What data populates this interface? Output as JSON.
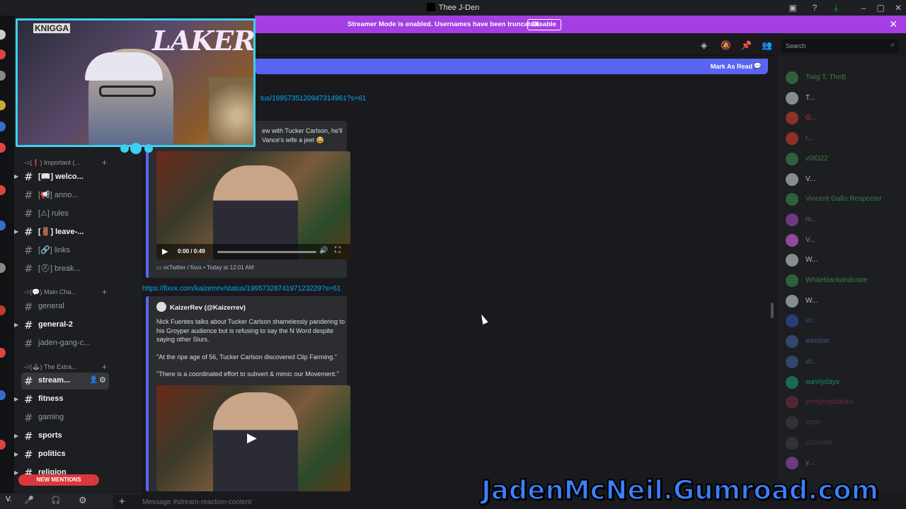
{
  "window": {
    "title": "Thee J-Den"
  },
  "banner": {
    "text": "Streamer Mode is enabled. Usernames have been truncated.",
    "disable_label": "Disable"
  },
  "header": {
    "search_placeholder": "Search"
  },
  "new_messages_bar": {
    "label": "Mark As Read"
  },
  "sidebar": {
    "categories": [
      {
        "label": "-=(❗) Important (...",
        "plus": "+"
      },
      {
        "label": "-=(💬) Main Cha...",
        "plus": "+"
      },
      {
        "label": "-=(🕹) The Extra...",
        "plus": "+"
      }
    ],
    "channels": [
      {
        "name": "[📖] welco...",
        "bold": true
      },
      {
        "name": "[📢] anno...",
        "bold": false
      },
      {
        "name": "[⚠] rules",
        "bold": false
      },
      {
        "name": "[🚪] leave-...",
        "bold": true
      },
      {
        "name": "[🔗] links",
        "bold": false
      },
      {
        "name": "[⛑] break...",
        "bold": false
      },
      {
        "name": "general",
        "bold": false
      },
      {
        "name": "general-2",
        "bold": true
      },
      {
        "name": "jaden-gang-c...",
        "bold": false
      },
      {
        "name": "stream...",
        "bold": true,
        "selected": true
      },
      {
        "name": "fitness",
        "bold": true
      },
      {
        "name": "gaming",
        "bold": false
      },
      {
        "name": "sports",
        "bold": true
      },
      {
        "name": "politics",
        "bold": true
      },
      {
        "name": "religion",
        "bold": true
      }
    ],
    "new_mentions": "NEW MENTIONS"
  },
  "messages": {
    "link1": "tus/1995735120947314961?s=61",
    "embed1": {
      "desc_line1": "ew with Tucker Carlson, he'll",
      "desc_line2": "Vance's wife a jeet 😂",
      "video_time": "0:00 / 0:49",
      "footer": "vxTwitter / fixvx • Today at 12:01 AM"
    },
    "link2": "https://fixvx.com/kaizerrev/status/1995732874197123229?s=61",
    "embed2": {
      "author": "KaizerRev (@Kaizerrev)",
      "p1": "Nick Fuentes talks about Tucker Carlson shamelessly pandering to his Groyper audience but is refusing to say the N Word despite saying other Slurs.",
      "p2": "\"At the ripe age of 56, Tucker Carlson discovered Clip Farming.\"",
      "p3": "\"There is a coordinated effort to subvert & mimic our Movement.\""
    }
  },
  "members": [
    {
      "name": "Twig T. TheB",
      "color": "#3a7a4a"
    },
    {
      "name": "T...",
      "color": "#b5bac1"
    },
    {
      "name": "G...",
      "color": "#c0392b"
    },
    {
      "name": "r...",
      "color": "#c0392b"
    },
    {
      "name": "v0ID22",
      "color": "#3a7a4a"
    },
    {
      "name": "V...",
      "color": "#b5bac1"
    },
    {
      "name": "Vincent Gallo Respecter",
      "color": "#3a7a4a"
    },
    {
      "name": "m...",
      "color": "#8e44ad"
    },
    {
      "name": "V...",
      "color": "#c45ad6"
    },
    {
      "name": "W...",
      "color": "#b5bac1"
    },
    {
      "name": "Whiteblackandcrate",
      "color": "#3a7a4a"
    },
    {
      "name": "W...",
      "color": "#b5bac1"
    },
    {
      "name": "vc...",
      "color": "#2e4a9a"
    },
    {
      "name": "winston",
      "color": "#3a5a8a"
    },
    {
      "name": "vc...",
      "color": "#3a5a8a"
    },
    {
      "name": "sunnydays",
      "color": "#1a8a6a"
    },
    {
      "name": "yeetyeepbanks",
      "color": "#6a2a3a"
    },
    {
      "name": "zepe",
      "color": "#3a3b40"
    },
    {
      "name": "Zidanelll",
      "color": "#3a3b40"
    },
    {
      "name": "y...",
      "color": "#8e44ad"
    }
  ],
  "composer": {
    "placeholder": "Message #stream-reaction-content"
  },
  "overlay": {
    "webcam_text": "LAKERS",
    "jersey_text": "KNIGGA",
    "gumroad": "JadenMcNeil.Gumroad.com"
  }
}
